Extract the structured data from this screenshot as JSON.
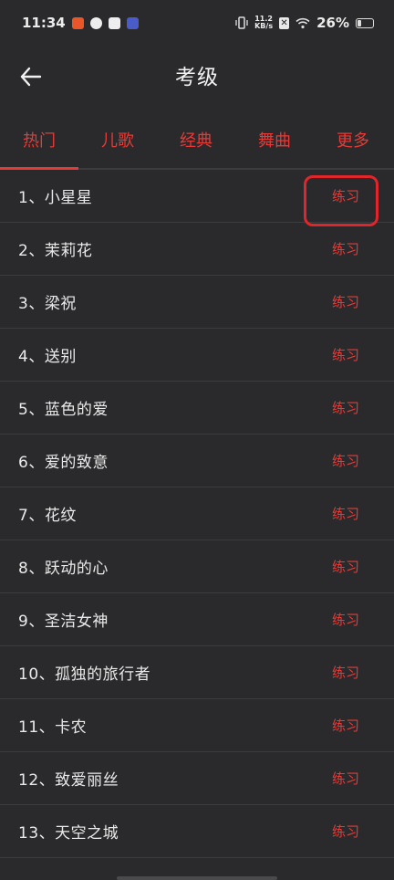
{
  "status_bar": {
    "time": "11:34",
    "net_speed_value": "11.2",
    "net_speed_unit": "KB/s",
    "battery": "26%",
    "battery_level": 0.26
  },
  "header": {
    "title": "考级"
  },
  "tabs": [
    {
      "label": "热门",
      "active": true
    },
    {
      "label": "儿歌",
      "active": false
    },
    {
      "label": "经典",
      "active": false
    },
    {
      "label": "舞曲",
      "active": false
    },
    {
      "label": "更多",
      "active": false
    }
  ],
  "songs": [
    {
      "name": "1、小星星",
      "action": "练习"
    },
    {
      "name": "2、茉莉花",
      "action": "练习"
    },
    {
      "name": "3、梁祝",
      "action": "练习"
    },
    {
      "name": "4、送别",
      "action": "练习"
    },
    {
      "name": "5、蓝色的爱",
      "action": "练习"
    },
    {
      "name": "6、爱的致意",
      "action": "练习"
    },
    {
      "name": "7、花纹",
      "action": "练习"
    },
    {
      "name": "8、跃动的心",
      "action": "练习"
    },
    {
      "name": "9、圣洁女神",
      "action": "练习"
    },
    {
      "name": "10、孤独的旅行者",
      "action": "练习"
    },
    {
      "name": "11、卡农",
      "action": "练习"
    },
    {
      "name": "12、致爱丽丝",
      "action": "练习"
    },
    {
      "name": "13、天空之城",
      "action": "练习"
    }
  ],
  "colors": {
    "accent": "#e63a36",
    "background": "#2a2a2c",
    "annotation": "#e0262a"
  }
}
